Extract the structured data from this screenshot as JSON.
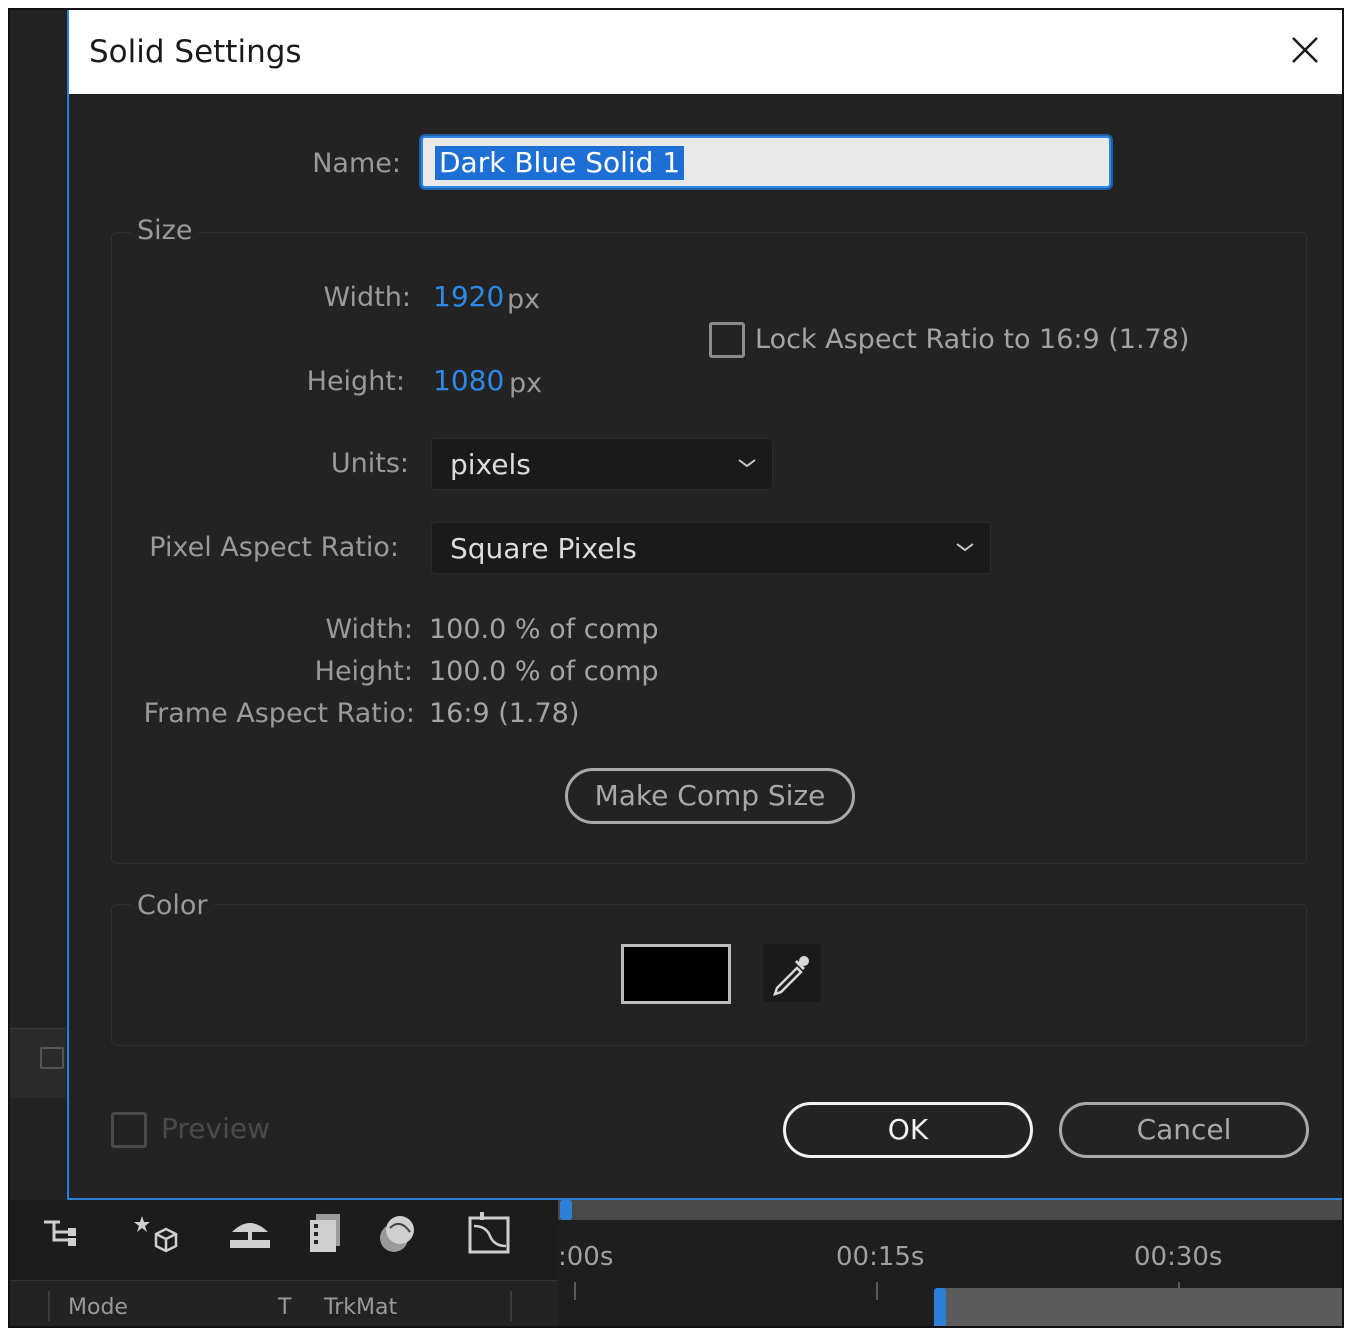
{
  "dialog": {
    "title": "Solid Settings",
    "name_label": "Name:",
    "name_value": "Dark Blue Solid 1",
    "size_group": "Size",
    "width_label": "Width:",
    "width_value": "1920",
    "width_unit": "px",
    "height_label": "Height:",
    "height_value": "1080",
    "height_unit": "px",
    "lock_label": "Lock Aspect Ratio to 16:9 (1.78)",
    "lock_checked": false,
    "units_label": "Units:",
    "units_value": "pixels",
    "par_label": "Pixel Aspect Ratio:",
    "par_value": "Square Pixels",
    "info_width_label": "Width:",
    "info_width_value": "100.0 % of comp",
    "info_height_label": "Height:",
    "info_height_value": "100.0 % of comp",
    "info_far_label": "Frame Aspect Ratio:",
    "info_far_value": "16:9 (1.78)",
    "make_comp_size": "Make Comp Size",
    "color_group": "Color",
    "color_value": "#000000",
    "preview_label": "Preview",
    "ok_label": "OK",
    "cancel_label": "Cancel"
  },
  "timeline": {
    "marks": [
      ":00s",
      "00:15s",
      "00:30s"
    ],
    "headers": {
      "mode": "Mode",
      "t": "T",
      "trkmat": "TrkMat"
    },
    "icons": [
      "shy-layers-icon",
      "3d-layer-icon",
      "motion-blur-icon",
      "frame-blending-icon",
      "draft-3d-icon",
      "graph-editor-icon"
    ]
  },
  "colors": {
    "accent": "#2d7fd8",
    "value_blue": "#2c8ae8",
    "panel": "#232323"
  }
}
